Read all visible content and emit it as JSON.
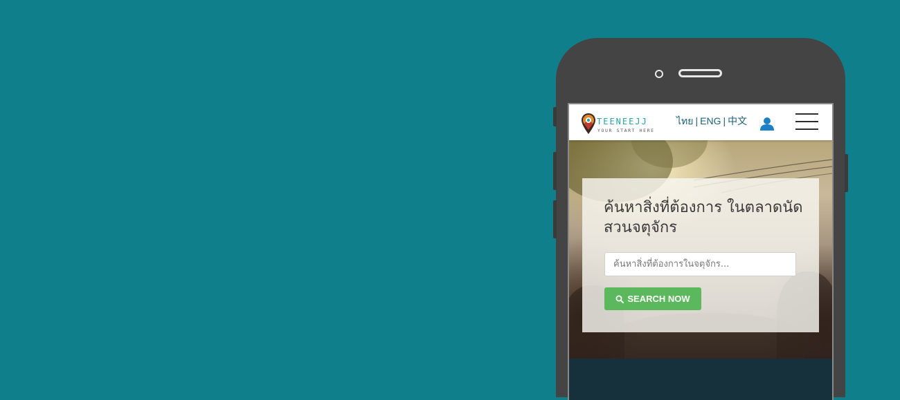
{
  "colors": {
    "background": "#0f7f8c",
    "phone_body": "#444444",
    "logo_accent": "#2aa3a3",
    "lang_link": "#1d5f7a",
    "user_icon": "#1d7fc4",
    "search_button": "#5cb85c",
    "footer": "#16313c"
  },
  "navbar": {
    "logo": {
      "name": "TEENEEJJ",
      "tagline": "YOUR START HERE",
      "icon": "map-pin-icon"
    },
    "languages": [
      "ไทย",
      "ENG",
      "中文"
    ],
    "separator": "|",
    "user_icon": "user-icon",
    "menu_icon": "hamburger-menu-icon"
  },
  "hero": {
    "headline": "ค้นหาสิ่งที่ต้องการ ในตลาดนัดสวนจตุจักร",
    "search": {
      "placeholder": "ค้นหาสิ่งที่ต้องการในจตุจักร...",
      "value": ""
    },
    "button": {
      "label": "SEARCH NOW",
      "icon": "search-icon"
    }
  }
}
